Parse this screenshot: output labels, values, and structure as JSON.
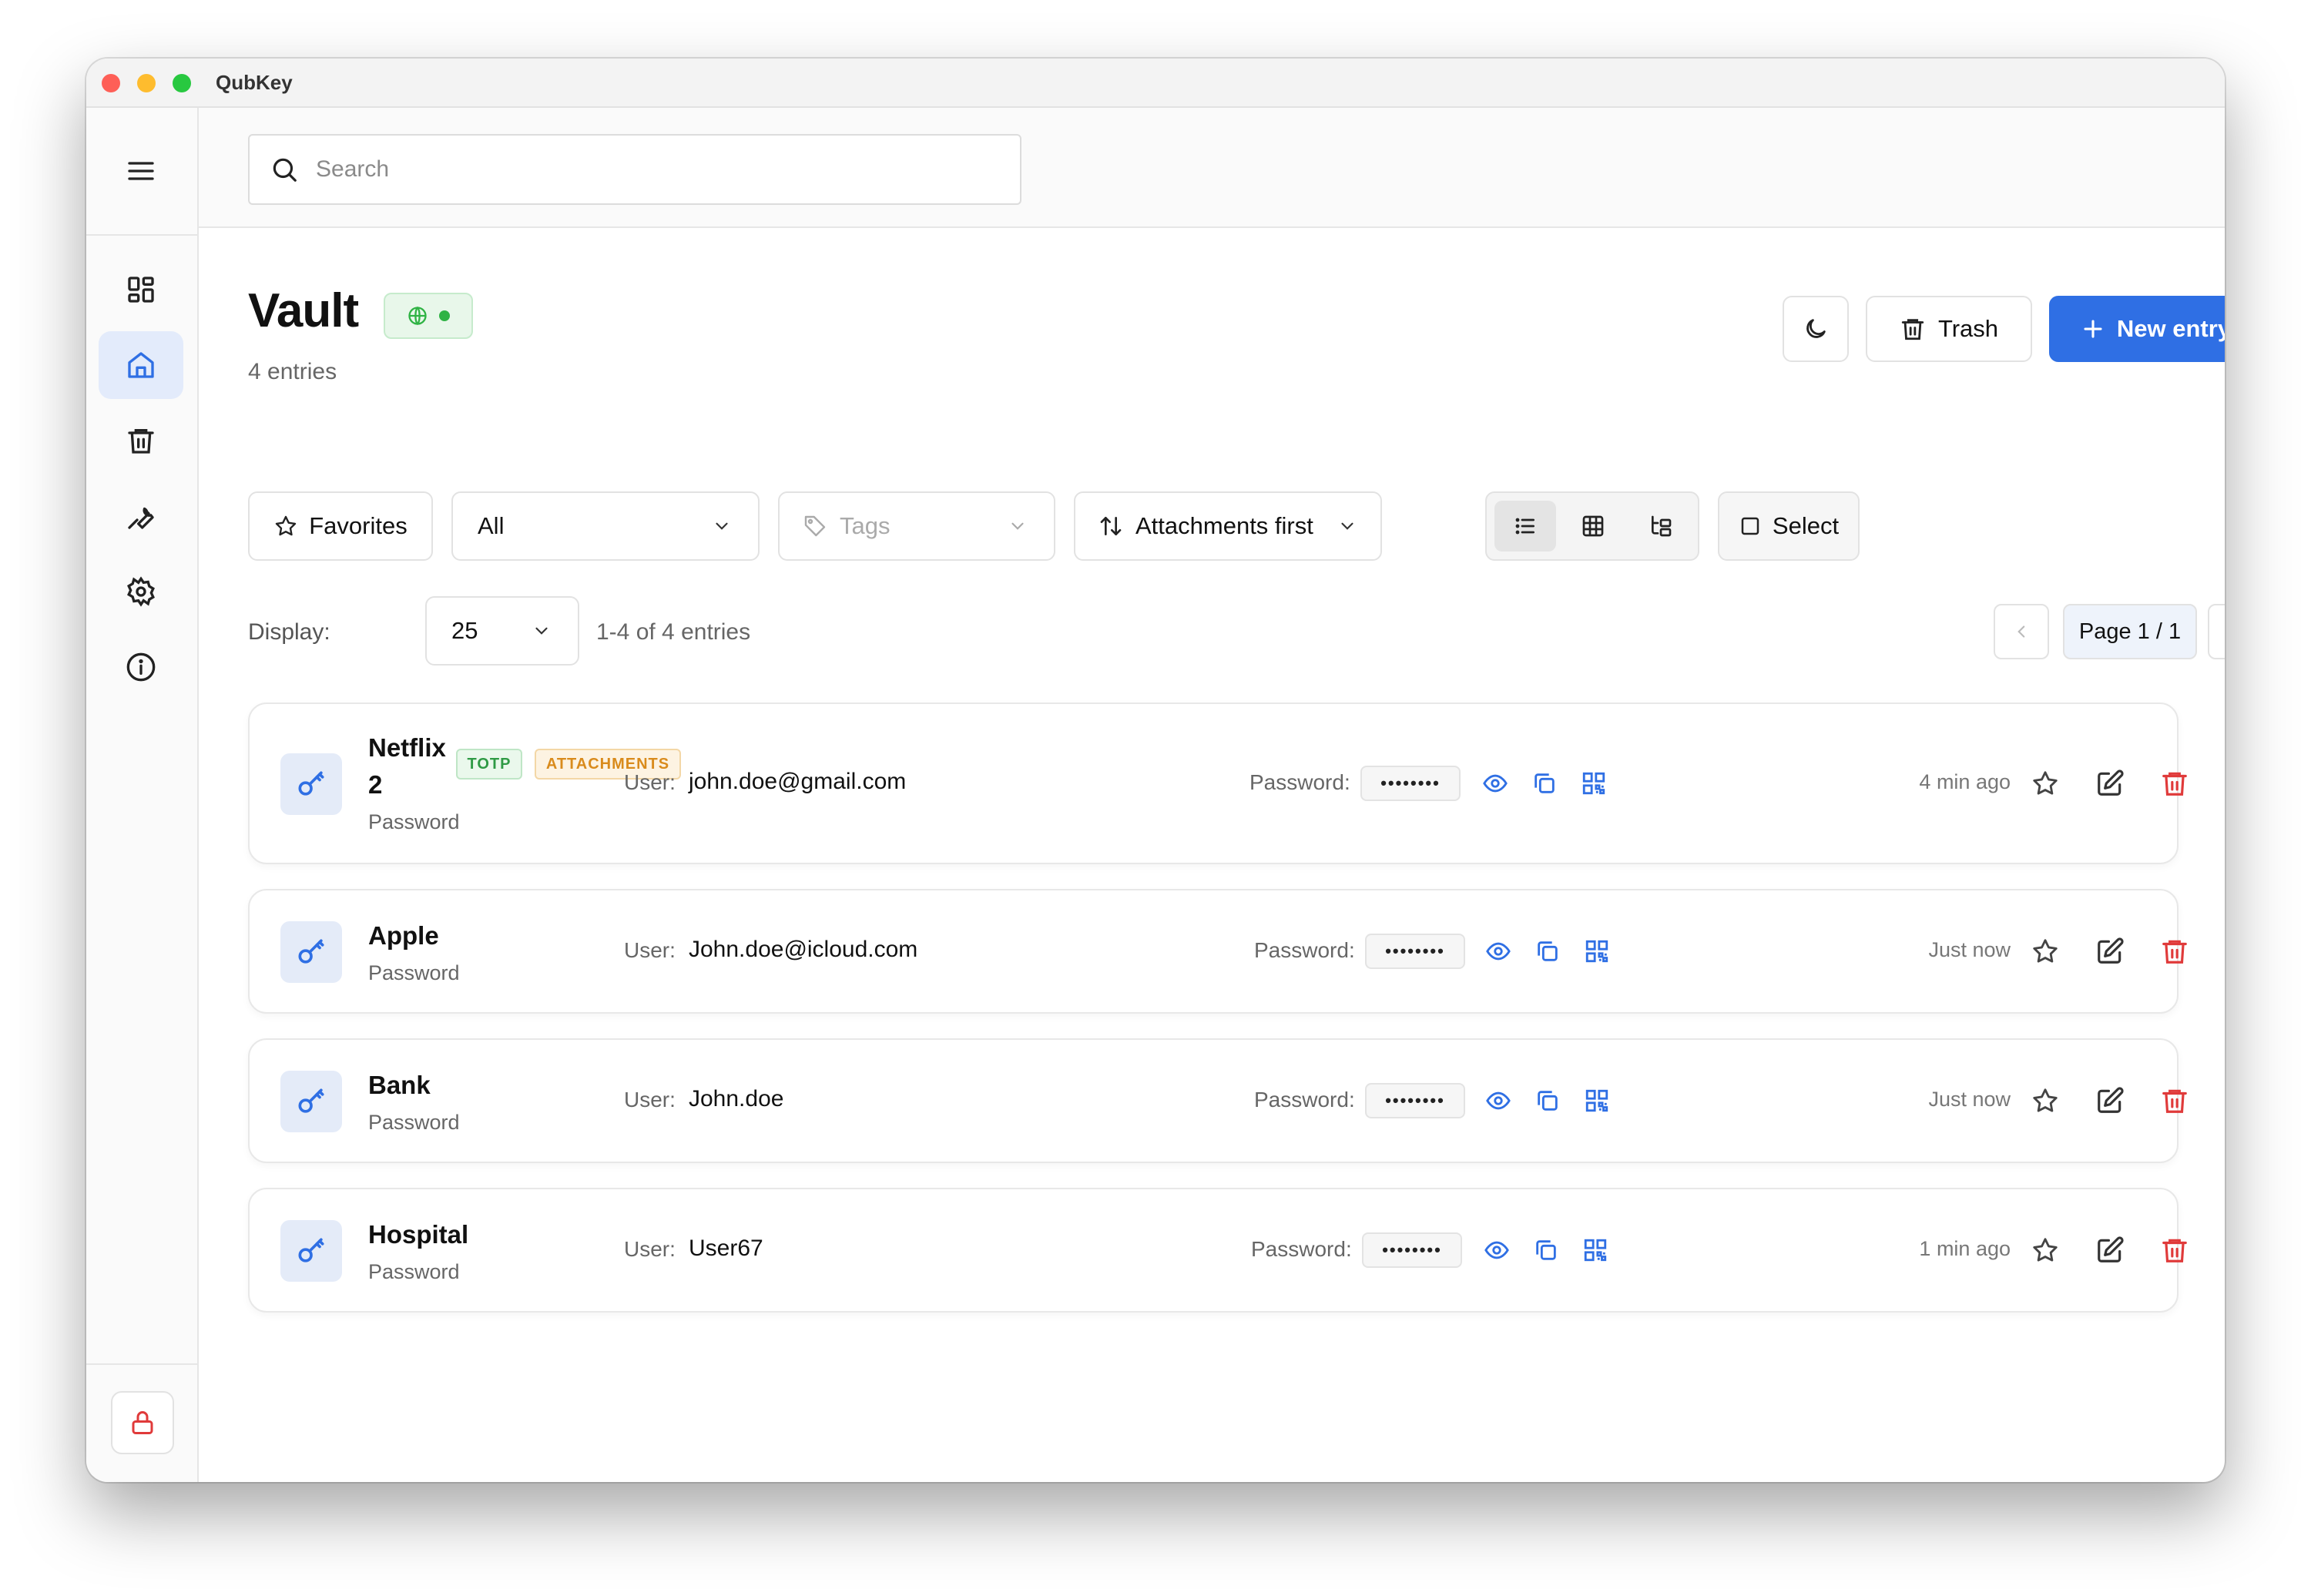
{
  "window": {
    "title": "QubKey"
  },
  "search": {
    "placeholder": "Search"
  },
  "header": {
    "title": "Vault",
    "entries_count": "4 entries",
    "trash_label": "Trash",
    "new_entry_label": "New entry"
  },
  "filters": {
    "favorites_label": "Favorites",
    "category_value": "All",
    "tags_placeholder": "Tags",
    "sort_label": "Attachments first",
    "select_label": "Select"
  },
  "pagination": {
    "display_label": "Display:",
    "page_size": "25",
    "range_text": "1-4 of 4 entries",
    "page_label": "Page 1 / 1"
  },
  "entries": [
    {
      "name_line1": "Netflix",
      "name_line2": "2",
      "type": "Password",
      "user_label": "User:",
      "user": "john.doe@gmail.com",
      "password_label": "Password:",
      "password_mask": "••••••••",
      "time": "4 min ago",
      "badges": [
        "TOTP",
        "ATTACHMENTS"
      ]
    },
    {
      "name": "Apple",
      "type": "Password",
      "user_label": "User:",
      "user": "John.doe@icloud.com",
      "password_label": "Password:",
      "password_mask": "••••••••",
      "time": "Just now"
    },
    {
      "name": "Bank",
      "type": "Password",
      "user_label": "User:",
      "user": "John.doe",
      "password_label": "Password:",
      "password_mask": "••••••••",
      "time": "Just now"
    },
    {
      "name": "Hospital",
      "type": "Password",
      "user_label": "User:",
      "user": "User67",
      "password_label": "Password:",
      "password_mask": "••••••••",
      "time": "1 min ago"
    }
  ],
  "icons": {
    "sidebar": [
      "menu-icon",
      "dashboard-icon",
      "home-icon",
      "trash-icon",
      "tools-icon",
      "settings-icon",
      "info-icon",
      "lock-icon"
    ],
    "entry_actions": [
      "eye-icon",
      "copy-icon",
      "qr-code-icon",
      "star-icon",
      "edit-icon",
      "delete-icon"
    ]
  },
  "colors": {
    "accent": "#2f6fe4",
    "danger": "#e03a3a",
    "success": "#2fb344",
    "warning": "#d98b1c"
  }
}
